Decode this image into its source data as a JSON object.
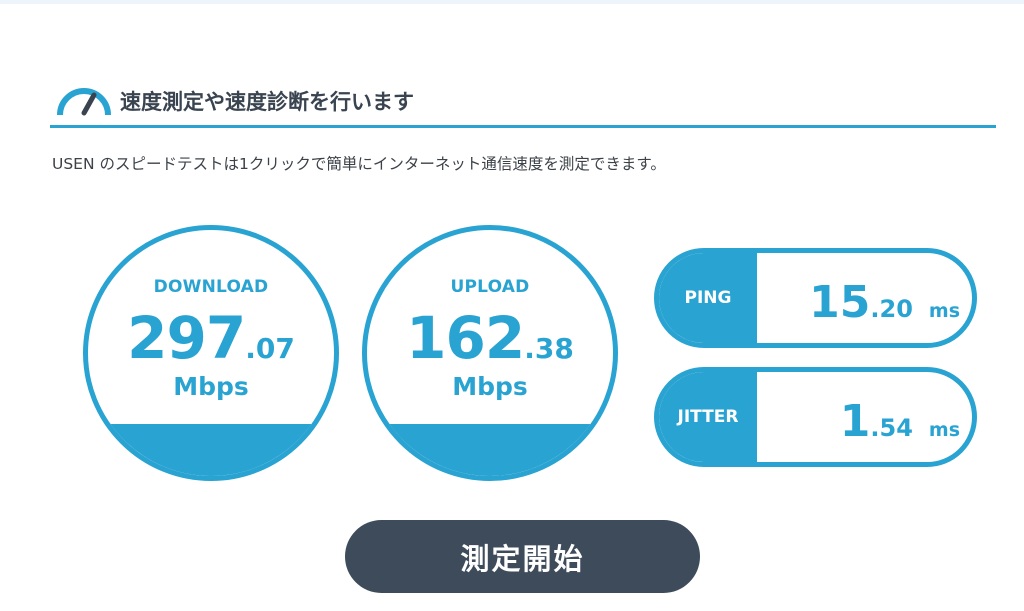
{
  "header": {
    "title": "速度測定や速度診断を行います",
    "icon": "speedometer-icon",
    "description": "USEN のスピードテストは1クリックで簡単にインターネット通信速度を測定できます。"
  },
  "download": {
    "label": "DOWNLOAD",
    "value_int": "297",
    "value_dec": ".07",
    "unit": "Mbps",
    "fill_fraction": 0.21
  },
  "upload": {
    "label": "UPLOAD",
    "value_int": "162",
    "value_dec": ".38",
    "unit": "Mbps",
    "fill_fraction": 0.21
  },
  "ping": {
    "label": "PING",
    "value_int": "15",
    "value_dec": ".20",
    "unit": "ms"
  },
  "jitter": {
    "label": "JITTER",
    "value_int": "1",
    "value_dec": ".54",
    "unit": "ms"
  },
  "start_button": {
    "label": "測定開始"
  },
  "colors": {
    "accent": "#29a3d2",
    "button": "#3d4b5a",
    "text": "#3a3f45"
  }
}
